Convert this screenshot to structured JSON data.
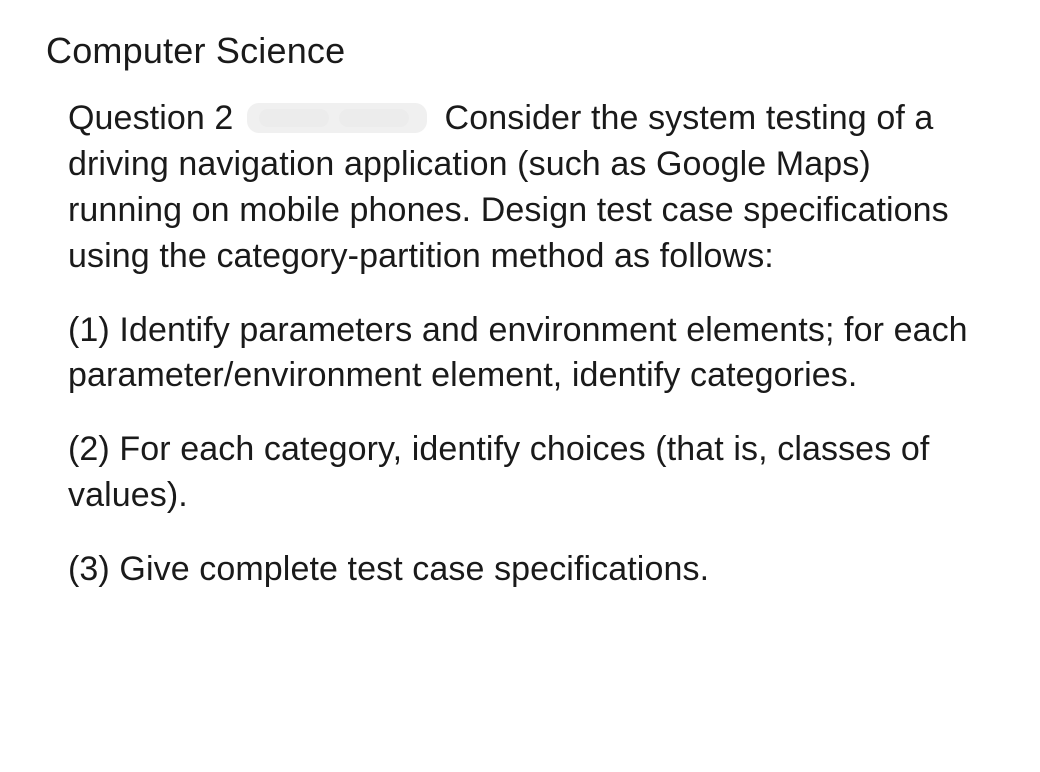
{
  "subject": "Computer Science",
  "question": {
    "label": "Question 2",
    "intro": "Consider the system testing of a driving navigation application (such as Google Maps) running on mobile phones. Design test case specifications using the category-partition method as follows:",
    "parts": [
      "(1) Identify parameters and environment elements; for each parameter/environment element, identify categories.",
      "(2) For each category, identify choices (that is, classes of values).",
      "(3) Give complete test case specifications."
    ]
  }
}
